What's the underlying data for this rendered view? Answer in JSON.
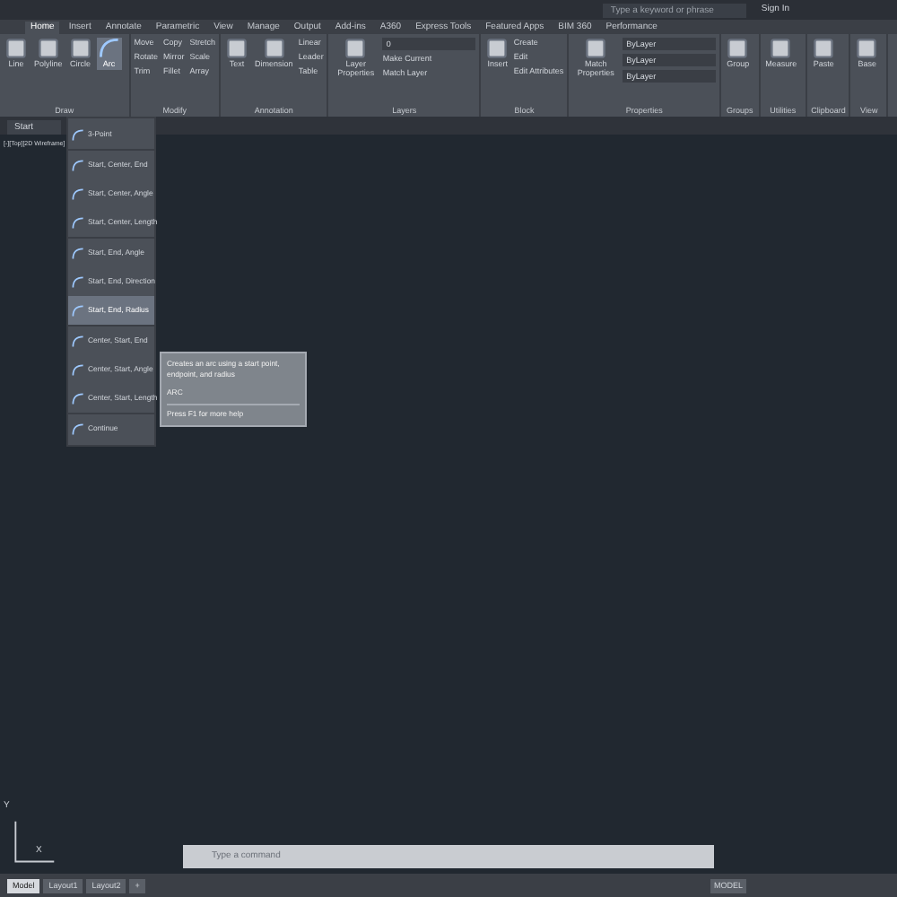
{
  "title_bar": {
    "search_placeholder": "Type a keyword or phrase",
    "sign_in": "Sign In"
  },
  "ribbon_tabs": [
    {
      "label": "Home",
      "selected": true
    },
    {
      "label": "Insert",
      "selected": false
    },
    {
      "label": "Annotate",
      "selected": false
    },
    {
      "label": "Parametric",
      "selected": false
    },
    {
      "label": "View",
      "selected": false
    },
    {
      "label": "Manage",
      "selected": false
    },
    {
      "label": "Output",
      "selected": false
    },
    {
      "label": "Add-ins",
      "selected": false
    },
    {
      "label": "A360",
      "selected": false
    },
    {
      "label": "Express Tools",
      "selected": false
    },
    {
      "label": "Featured Apps",
      "selected": false
    },
    {
      "label": "BIM 360",
      "selected": false
    },
    {
      "label": "Performance",
      "selected": false
    }
  ],
  "panels": [
    {
      "label": "Draw",
      "large": [
        {
          "label": "Line",
          "selected": false
        },
        {
          "label": "Polyline",
          "selected": false
        },
        {
          "label": "Circle",
          "selected": false
        },
        {
          "label": "Arc",
          "selected": true
        }
      ]
    },
    {
      "label": "Modify",
      "small": [
        "Move",
        "Rotate",
        "Trim",
        "Copy",
        "Mirror",
        "Fillet",
        "Stretch",
        "Scale",
        "Array"
      ]
    },
    {
      "label": "Annotation",
      "large": [
        {
          "label": "Text",
          "selected": false
        },
        {
          "label": "Dimension",
          "selected": false
        }
      ],
      "small": [
        "Linear",
        "Leader",
        "Table"
      ]
    },
    {
      "label": "Layers",
      "large": [
        {
          "label": "Layer Properties",
          "selected": false
        }
      ],
      "small": [
        "Make Current",
        "Match Layer"
      ],
      "dropdowns": [
        "0"
      ]
    },
    {
      "label": "Block",
      "large": [
        {
          "label": "Insert",
          "selected": false
        }
      ],
      "small": [
        "Create",
        "Edit",
        "Edit Attributes"
      ]
    },
    {
      "label": "Properties",
      "large": [
        {
          "label": "Match Properties",
          "selected": false
        }
      ],
      "dropdowns": [
        "ByLayer",
        "ByLayer",
        "ByLayer"
      ]
    },
    {
      "label": "Groups",
      "large": [
        {
          "label": "Group",
          "selected": false
        }
      ]
    },
    {
      "label": "Utilities",
      "large": [
        {
          "label": "Measure",
          "selected": false
        }
      ]
    },
    {
      "label": "Clipboard",
      "large": [
        {
          "label": "Paste",
          "selected": false
        }
      ]
    },
    {
      "label": "View",
      "large": [
        {
          "label": "Base",
          "selected": false
        }
      ]
    }
  ],
  "file_tab": "Start",
  "viewport_label": "[-][Top][2D Wireframe]",
  "arc_menu": [
    [
      {
        "label": "3-Point",
        "selected": false
      }
    ],
    [
      {
        "label": "Start, Center, End",
        "selected": false
      },
      {
        "label": "Start, Center, Angle",
        "selected": false
      },
      {
        "label": "Start, Center, Length",
        "selected": false
      }
    ],
    [
      {
        "label": "Start, End, Angle",
        "selected": false
      },
      {
        "label": "Start, End, Direction",
        "selected": false
      },
      {
        "label": "Start, End, Radius",
        "selected": true
      }
    ],
    [
      {
        "label": "Center, Start, End",
        "selected": false
      },
      {
        "label": "Center, Start, Angle",
        "selected": false
      },
      {
        "label": "Center, Start, Length",
        "selected": false
      }
    ],
    [
      {
        "label": "Continue",
        "selected": false
      }
    ]
  ],
  "tooltip": {
    "description": "Creates an arc using a start point, endpoint, and radius",
    "command": "ARC",
    "help": "Press F1 for more help"
  },
  "ucs": {
    "y": "Y",
    "x": "X"
  },
  "command_line": {
    "placeholder": "Type a command"
  },
  "layout_tabs": [
    {
      "label": "Model",
      "selected": true
    },
    {
      "label": "Layout1",
      "selected": false
    },
    {
      "label": "Layout2",
      "selected": false
    },
    {
      "label": "+",
      "selected": false
    }
  ],
  "status_bar": {
    "mode": "MODEL"
  }
}
